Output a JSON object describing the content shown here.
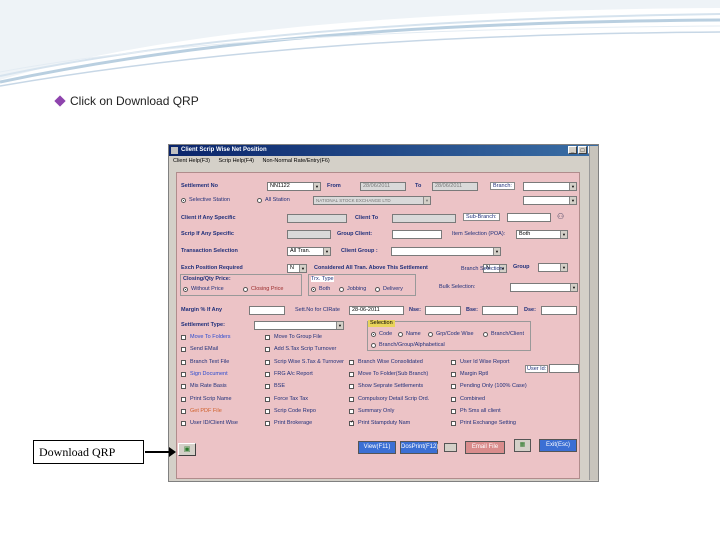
{
  "slide": {
    "bullet_text": "Click  on Download QRP",
    "callout_text": "Download  QRP",
    "accent": "#8e44ad"
  },
  "window": {
    "title": "Client Scrip Wise Net Position",
    "menu": [
      "Client Help(F3)",
      "Scrip Help(F4)",
      "Non-Normal Rate/Entry(F6)"
    ],
    "min": "_",
    "max": "□",
    "close": "×"
  },
  "form": {
    "settlement_no_label": "Settlement No",
    "settlement_no_value": "NN1122",
    "from_label": "From",
    "from_value": "28/06/2011",
    "to_label": "To",
    "to_value": "28/06/2011",
    "branch_label": "Branch:",
    "selective_station": "Selective Station",
    "all_station": "All Station",
    "station_value": "NATIONAL STOCK EXCHANGE LTD",
    "client_if_any": "Client if Any Specific",
    "client_to": "Client To",
    "sub_branch": "Sub-Branch:",
    "scrip_if_any": "Scrip If Any Specific",
    "group_client": "Group Client:",
    "item_selection": "Item Selection (POA):",
    "item_selection_value": "Both",
    "transaction_selection": "Transaction Selection",
    "transaction_value": "All Tran.",
    "client_group": "Client Group :",
    "exch_position": "Exch Position Required",
    "exch_value": "N",
    "considered_all": "Considered All Tran. Above This Settlement",
    "considered_value": "N",
    "group_label": "Group",
    "closing_qty_price": "Closing/Qty Price:",
    "without_price": "Without Price",
    "closing_price": "Closing Price",
    "trx_type": "Trx. Type",
    "both": "Both",
    "jobbing": "Jobbing",
    "delivery": "Delivery",
    "bulk_selection": "Bulk Selection:",
    "branch_selection": "Branch Selection:",
    "margin_label": "Margin % If Any",
    "sett_no_for_cirate": "Sett.No for CIRate",
    "sett_date": "28-06-2011",
    "nse_label": "Nse:",
    "bse_label": "Bse:",
    "dse_label": "Dse:",
    "settlement_type": "Settlement Type:",
    "selection": "Selection",
    "code": "Code",
    "name": "Name",
    "grp_code_wise": "Grp/Code Wise",
    "branch_client": "Branch/Client",
    "branch_group_alpha": "Branch/Group/Alphabetical",
    "user_id": "User Id:"
  },
  "checkboxes": [
    [
      "Move To Folders",
      "Move To Group File",
      "",
      "",
      ""
    ],
    [
      "Send EMail",
      "Add S.Tax Scrip Turnover",
      "",
      "",
      ""
    ],
    [
      "Branch Text File",
      "Scrip Wise S.Tax & Turnover",
      "Branch Wise Consolidated",
      "User Id Wise Report",
      ""
    ],
    [
      "Sign Document",
      "FRG A/c Report",
      "Move To Folder(Sub Branch)",
      "Margin Rptl",
      ""
    ],
    [
      "Mis Rate Basis",
      "BSE",
      "Show Seprate Settlements",
      "Pending Only (100% Case)",
      ""
    ],
    [
      "Print Scrip Name",
      "Force Tax Tax",
      "Compulsory Detail Scrip Ord.",
      "Combined",
      ""
    ],
    [
      "Get PDF File",
      "Scrip Code Repo",
      "Summary Only",
      "Ph Sms all client",
      ""
    ],
    [
      "User ID/Client Wise",
      "Print Brokerage",
      "Print Stampduty Nam",
      "Print Exchange Setting",
      ""
    ]
  ],
  "buttons": {
    "view": "View(F11)",
    "dosprint": "DosPrint(F12)",
    "email": "Email File",
    "exit": "Exit(Esc)"
  },
  "colors": {
    "panel": "#ecc3c6",
    "label": "#1f2f7a",
    "title_start": "#0a246a",
    "view_btn": "#3b6fd4",
    "email_btn": "#d98c8c"
  }
}
